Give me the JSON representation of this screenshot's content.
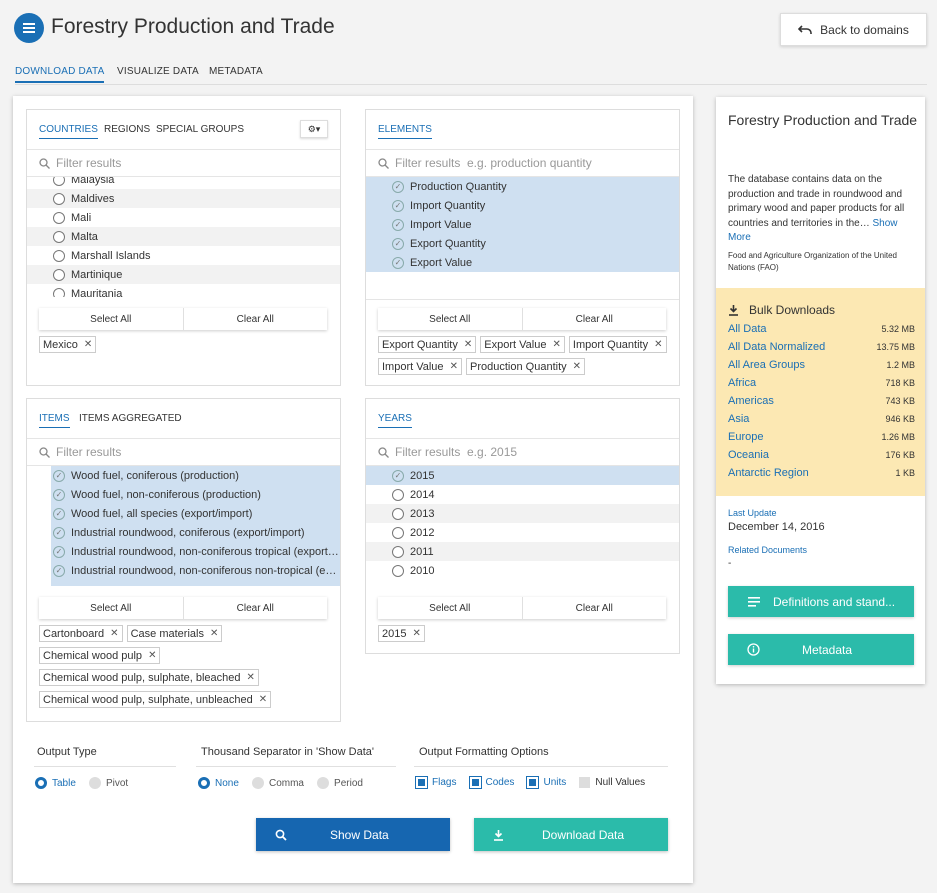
{
  "header": {
    "title": "Forestry Production and Trade",
    "back_label": "Back to domains"
  },
  "tabs": [
    {
      "label": "DOWNLOAD DATA",
      "active": true
    },
    {
      "label": "VISUALIZE DATA",
      "active": false
    },
    {
      "label": "METADATA",
      "active": false
    }
  ],
  "countries": {
    "tabs": [
      "COUNTRIES",
      "REGIONS",
      "SPECIAL GROUPS"
    ],
    "filter_placeholder": "Filter results",
    "items": [
      "Malaysia",
      "Maldives",
      "Mali",
      "Malta",
      "Marshall Islands",
      "Martinique",
      "Mauritania"
    ],
    "select_all": "Select All",
    "clear_all": "Clear All",
    "selected": [
      "Mexico"
    ]
  },
  "elements": {
    "tabs": [
      "ELEMENTS"
    ],
    "filter_placeholder": "Filter results  e.g. production quantity",
    "items": [
      "Production Quantity",
      "Import Quantity",
      "Import Value",
      "Export Quantity",
      "Export Value"
    ],
    "select_all": "Select All",
    "clear_all": "Clear All",
    "selected": [
      "Export Quantity",
      "Export Value",
      "Import Quantity",
      "Import Value",
      "Production Quantity"
    ]
  },
  "items": {
    "tabs": [
      "ITEMS",
      "ITEMS AGGREGATED"
    ],
    "filter_placeholder": "Filter results",
    "items": [
      "Wood fuel, coniferous (production)",
      "Wood fuel, non-coniferous (production)",
      "Wood fuel, all species (export/import)",
      "Industrial roundwood, coniferous (export/import)",
      "Industrial roundwood, non-coniferous tropical (export…",
      "Industrial roundwood, non-coniferous non-tropical (e…"
    ],
    "select_all": "Select All",
    "clear_all": "Clear All",
    "selected": [
      "Cartonboard",
      "Case materials",
      "Chemical wood pulp",
      "Chemical wood pulp, sulphate, bleached",
      "Chemical wood pulp, sulphate, unbleached"
    ]
  },
  "years": {
    "tabs": [
      "YEARS"
    ],
    "filter_placeholder": "Filter results  e.g. 2015",
    "items": [
      "2015",
      "2014",
      "2013",
      "2012",
      "2011",
      "2010"
    ],
    "select_all": "Select All",
    "clear_all": "Clear All",
    "selected": [
      "2015"
    ]
  },
  "output": {
    "output_type_label": "Output Type",
    "output_type_options": [
      {
        "label": "Table",
        "on": true
      },
      {
        "label": "Pivot",
        "on": false
      }
    ],
    "thousand_label": "Thousand Separator in 'Show Data'",
    "thousand_options": [
      {
        "label": "None",
        "on": true
      },
      {
        "label": "Comma",
        "on": false
      },
      {
        "label": "Period",
        "on": false
      }
    ],
    "format_label": "Output Formatting Options",
    "format_options": [
      {
        "label": "Flags",
        "on": true
      },
      {
        "label": "Codes",
        "on": true
      },
      {
        "label": "Units",
        "on": true
      },
      {
        "label": "Null Values",
        "on": false
      }
    ],
    "show_data": "Show Data",
    "download_data": "Download Data"
  },
  "sidebar": {
    "title": "Forestry Production and Trade",
    "description": "The database contains data on the production and trade in roundwood and primary wood and paper products for all countries and territories in the…",
    "show_more": "Show More",
    "organization": "Food and Agriculture Organization of the United Nations (FAO)",
    "bulk_title": "Bulk Downloads",
    "bulk": [
      {
        "name": "All Data",
        "size": "5.32 MB"
      },
      {
        "name": "All Data Normalized",
        "size": "13.75 MB"
      },
      {
        "name": "All Area Groups",
        "size": "1.2 MB"
      },
      {
        "name": "Africa",
        "size": "718 KB"
      },
      {
        "name": "Americas",
        "size": "743 KB"
      },
      {
        "name": "Asia",
        "size": "946 KB"
      },
      {
        "name": "Europe",
        "size": "1.26 MB"
      },
      {
        "name": "Oceania",
        "size": "176 KB"
      },
      {
        "name": "Antarctic Region",
        "size": "1 KB"
      }
    ],
    "last_update_label": "Last Update",
    "last_update": "December 14, 2016",
    "related_label": "Related Documents",
    "related_value": "-",
    "definitions_btn": "Definitions and stand...",
    "metadata_btn": "Metadata"
  },
  "colors": {
    "accent": "#1a6fb5",
    "teal": "#2bbbaa",
    "bulk_bg": "#fce8b3",
    "selected_row": "#cfe0f1"
  }
}
